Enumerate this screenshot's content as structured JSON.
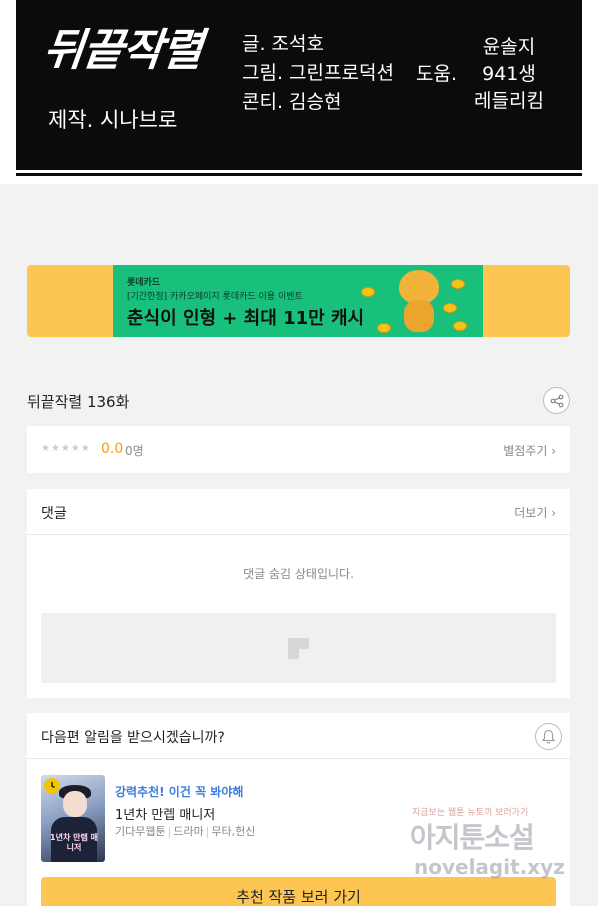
{
  "credits": {
    "logo": "뒤끝작렬",
    "producer": "제작. 시나브로",
    "writer": "글. 조석호",
    "art": "그림. 그린프로덕션",
    "storyboard": "콘티. 김승현",
    "assist_label": "도움.",
    "assistants": [
      "윤솔지",
      "941생",
      "레들리킴"
    ]
  },
  "banner": {
    "brand": "롯데카드",
    "subtitle": "[기간한정] 카카오페이지 롯데카드 이용 이벤트",
    "title": "춘식이 인형 + 최대 11만 캐시",
    "colors": {
      "outer": "#fdc653",
      "inner": "#19c07b"
    }
  },
  "episode": {
    "title": "뒤끝작렬 136화"
  },
  "rating": {
    "stars": "★★★★★",
    "score": "0.0",
    "count": "0명",
    "rate_button": "별점주기 ›"
  },
  "comments": {
    "title": "댓글",
    "more": "더보기 ›",
    "hidden_notice": "댓글 숨김 상태입니다."
  },
  "next": {
    "question": "다음편 알림을 받으시겠습니까?",
    "recommendation": {
      "tag": "강력추천! 이건 꼭 봐야해",
      "name": "1년차 만렙 매니저",
      "genres": [
        "기다무웹툰",
        "드라마",
        "무타,헌신"
      ],
      "thumb_title": "1년차 만렙 매니저"
    },
    "cta": "추천 작품 보러 가기"
  },
  "watermark": {
    "top": "지금보는 웹툰 뉴토끼 보러가기",
    "mid": "아지툰소설",
    "bottom": "novelagit.xyz"
  }
}
